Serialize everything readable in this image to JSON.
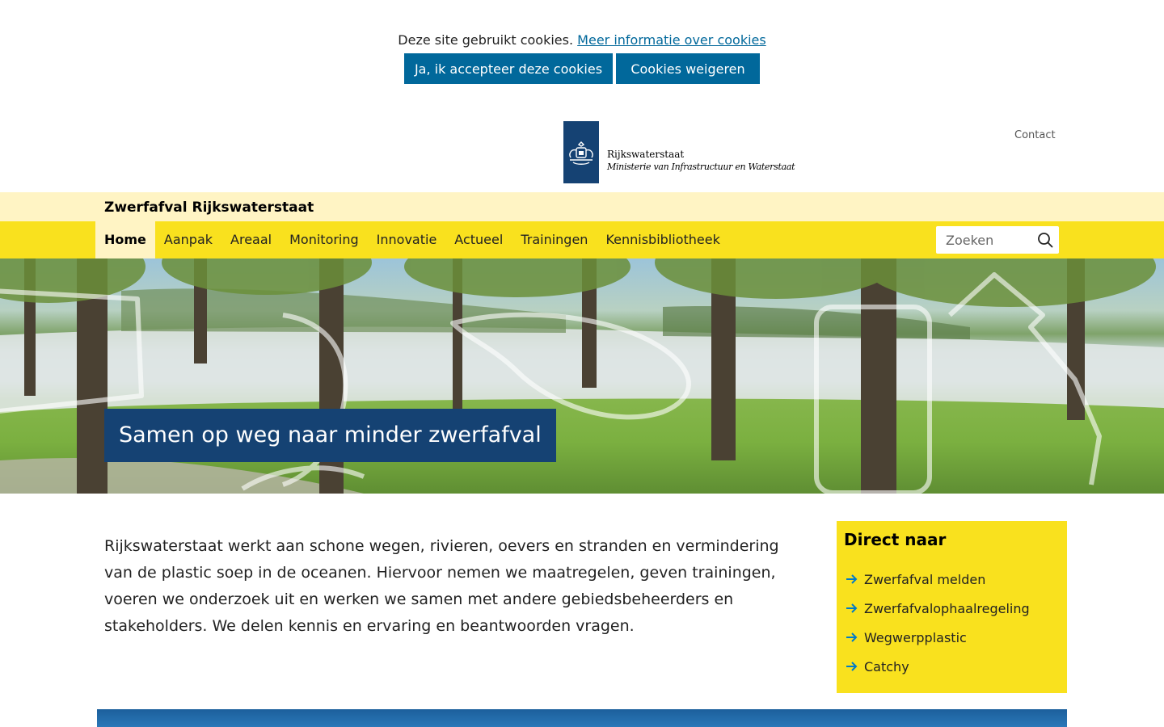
{
  "cookie_bar": {
    "message": "Deze site gebruikt cookies.",
    "more_info_link": "Meer informatie over cookies",
    "accept_label": "Ja, ik accepteer deze cookies",
    "refuse_label": "Cookies weigeren"
  },
  "header": {
    "logo_org": "Rijkswaterstaat",
    "logo_ministry": "Ministerie van Infrastructuur en Waterstaat",
    "contact_link": "Contact",
    "logo_color": "#154273"
  },
  "site": {
    "title": "Zwerfafval Rijkswaterstaat"
  },
  "nav": {
    "items": [
      {
        "label": "Home",
        "active": true
      },
      {
        "label": "Aanpak"
      },
      {
        "label": "Areaal"
      },
      {
        "label": "Monitoring"
      },
      {
        "label": "Innovatie"
      },
      {
        "label": "Actueel"
      },
      {
        "label": "Trainingen"
      },
      {
        "label": "Kennisbibliotheek"
      }
    ],
    "search_placeholder": "Zoeken",
    "accent": "#f9e11e"
  },
  "hero": {
    "title": "Samen op weg naar minder zwerfafval"
  },
  "main": {
    "intro": "Rijkswaterstaat werkt aan schone wegen, rivieren, oevers en stranden en vermindering van de plastic soep in de oceanen. Hiervoor nemen we maatregelen, geven trainingen, voeren we onderzoek uit en werken we samen met andere gebiedsbeheerders en stakeholders. We delen kennis en ervaring en beantwoorden vragen."
  },
  "direct_naar": {
    "heading": "Direct naar",
    "links": [
      {
        "label": "Zwerfafval melden"
      },
      {
        "label": "Zwerfafvalophaalregeling"
      },
      {
        "label": "Wegwerpplastic"
      },
      {
        "label": "Catchy"
      }
    ]
  }
}
